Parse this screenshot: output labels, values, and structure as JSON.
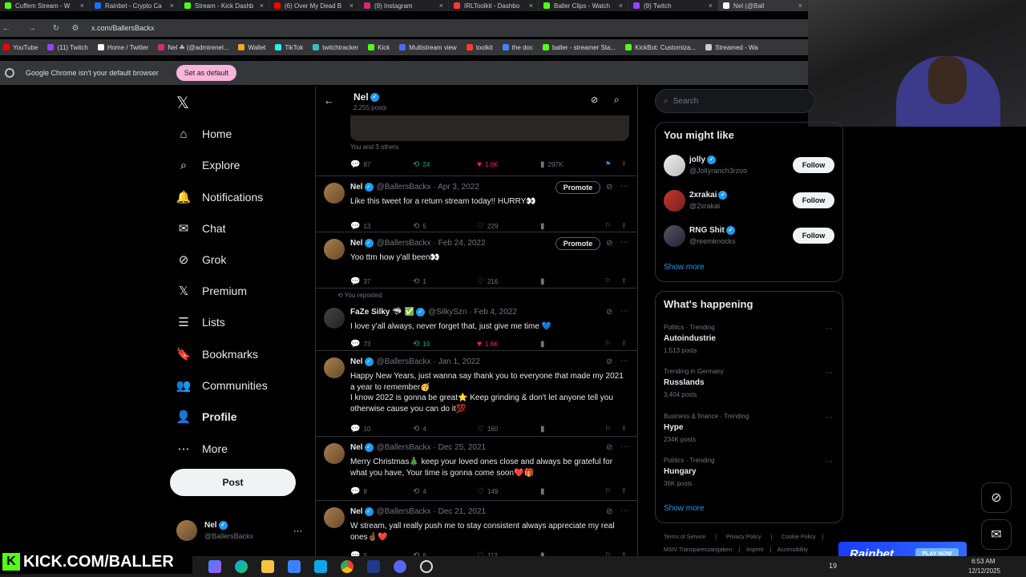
{
  "browser": {
    "tabs": [
      {
        "label": "Cuffem Stream - W",
        "color": "#53fc18"
      },
      {
        "label": "Rainbet - Crypto Ca",
        "color": "#1d6fff"
      },
      {
        "label": "Stream - Kick Dashb",
        "color": "#53fc18"
      },
      {
        "label": "(6) Over My Dead B",
        "color": "#ff0000"
      },
      {
        "label": "(9) Instagram",
        "color": "#d62976"
      },
      {
        "label": "IRLToolkit - Dashbo",
        "color": "#ff3b30"
      },
      {
        "label": "Baller Clips - Watch",
        "color": "#53fc18"
      },
      {
        "label": "(9) Twitch",
        "color": "#9146ff"
      },
      {
        "label": "Nel (@Ball",
        "color": "#ffffff"
      }
    ],
    "url": "x.com/BallersBackx",
    "bookmarks": [
      {
        "label": "YouTube",
        "color": "#ff0000"
      },
      {
        "label": "(11) Twitch",
        "color": "#9146ff"
      },
      {
        "label": "Home / Twitter",
        "color": "#ffffff"
      },
      {
        "label": "Nel ☘ (@admirenel...",
        "color": "#d62976"
      },
      {
        "label": "Wallet",
        "color": "#f5a623"
      },
      {
        "label": "TikTok",
        "color": "#25f4ee"
      },
      {
        "label": "twitchtracker",
        "color": "#3ac1b2"
      },
      {
        "label": "Kick",
        "color": "#53fc18"
      },
      {
        "label": "Multistream view",
        "color": "#4a6cf7"
      },
      {
        "label": "toolkit",
        "color": "#ff3b30"
      },
      {
        "label": "the doc",
        "color": "#4285f4"
      },
      {
        "label": "baller - streamer Sta...",
        "color": "#53fc18"
      },
      {
        "label": "KickBot: Customiza...",
        "color": "#53fc18"
      },
      {
        "label": "Streamed - Wa",
        "color": "#cccccc"
      }
    ],
    "infobar_text": "Google Chrome isn't your default browser",
    "set_default_label": "Set as default"
  },
  "sidebar": {
    "logo": "𝕏",
    "items": [
      {
        "label": "Home",
        "icon": "⌂"
      },
      {
        "label": "Explore",
        "icon": "⌕"
      },
      {
        "label": "Notifications",
        "icon": "🔔"
      },
      {
        "label": "Chat",
        "icon": "✉"
      },
      {
        "label": "Grok",
        "icon": "⊘"
      },
      {
        "label": "Premium",
        "icon": "𝕏"
      },
      {
        "label": "Lists",
        "icon": "☰"
      },
      {
        "label": "Bookmarks",
        "icon": "🔖"
      },
      {
        "label": "Communities",
        "icon": "👥"
      },
      {
        "label": "Profile",
        "icon": "👤"
      },
      {
        "label": "More",
        "icon": "⋯"
      }
    ],
    "post_label": "Post",
    "account": {
      "name": "Nel",
      "handle": "@BallersBackx"
    }
  },
  "header": {
    "name": "Nel",
    "posts": "2,255 posts"
  },
  "feed": {
    "first": {
      "likers": "You and 3 others",
      "replies": "87",
      "reposts": "24",
      "likes": "1.6K",
      "views": "297K"
    },
    "tweets": [
      {
        "name": "Nel",
        "handle": "@BallersBackx",
        "date": "· Apr 3, 2022",
        "text": "Like this tweet for a return stream today!! HURRY👀",
        "replies": "13",
        "reposts": "5",
        "likes": "229",
        "views": "",
        "promote": "Promote"
      },
      {
        "name": "Nel",
        "handle": "@BallersBackx",
        "date": "· Feb 24, 2022",
        "text": "Yoo ttm how y'all been👀",
        "replies": "37",
        "reposts": "1",
        "likes": "216",
        "views": "",
        "promote": "Promote"
      },
      {
        "repost_label": "You reposted",
        "name": "FaZe Silky 🦈 ✅",
        "handle": "@SilkySzn",
        "date": "· Feb 4, 2022",
        "text": "I love y'all always, never forget that, just give me time 💙",
        "replies": "73",
        "reposts": "19",
        "likes": "1.8K",
        "views": ""
      },
      {
        "name": "Nel",
        "handle": "@BallersBackx",
        "date": "· Jan 1, 2022",
        "text": "Happy New Years, just wanna say thank you to everyone that made my 2021 a year to remember🥳\nI know 2022 is gonna be great⭐ Keep grinding & don't let anyone tell you otherwise cause you can do it💯",
        "replies": "10",
        "reposts": "4",
        "likes": "160",
        "views": ""
      },
      {
        "name": "Nel",
        "handle": "@BallersBackx",
        "date": "· Dec 25, 2021",
        "text": "Merry Christmas🎄 keep your loved ones close and always be grateful for what you have, Your time is gonna come soon❤️🎁",
        "replies": "8",
        "reposts": "4",
        "likes": "149",
        "views": ""
      },
      {
        "name": "Nel",
        "handle": "@BallersBackx",
        "date": "· Dec 21, 2021",
        "text": "W stream, yall really push me to stay consistent always appreciate my real ones🤞🏾❤️",
        "replies": "5",
        "reposts": "6",
        "likes": "112",
        "views": ""
      }
    ]
  },
  "right": {
    "search_placeholder": "Search",
    "might_like_title": "You might like",
    "suggestions": [
      {
        "name": "jolly",
        "handle": "@Jollyranch3rzoo",
        "button": "Follow"
      },
      {
        "name": "2xrakai",
        "handle": "@2xrakai",
        "button": "Follow"
      },
      {
        "name": "RNG Shit",
        "handle": "@reemknocks",
        "button": "Follow"
      }
    ],
    "show_more": "Show more",
    "happening_title": "What's happening",
    "trends": [
      {
        "category": "Politics · Trending",
        "name": "Autoindustrie",
        "count": "1,513 posts"
      },
      {
        "category": "Trending in Germany",
        "name": "Russlands",
        "count": "3,404 posts"
      },
      {
        "category": "Business & finance · Trending",
        "name": "Hype",
        "count": "234K posts"
      },
      {
        "category": "Politics · Trending",
        "name": "Hungary",
        "count": "36K posts"
      }
    ],
    "show_more_2": "Show more",
    "footer": [
      "Terms of Service",
      "Privacy Policy",
      "Cookie Policy",
      "MStV Transparenzangaben",
      "Imprint",
      "Accessibility"
    ]
  },
  "overlay": {
    "kick_banner": "KICK.COM/BALLER",
    "rainbet_logo": "Rainbet",
    "play_now": "PLAY NOW",
    "time": "6:53 AM",
    "date": "12/12/2025",
    "temp": "19"
  }
}
